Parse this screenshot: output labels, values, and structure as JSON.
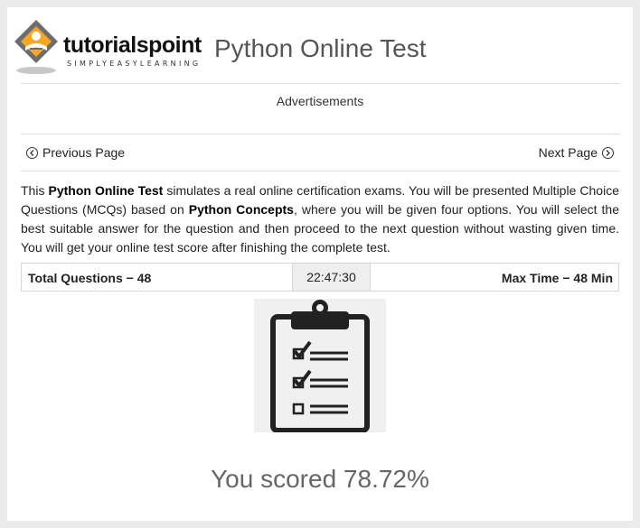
{
  "header": {
    "logo_text_main": "tutorials",
    "logo_text_accent": "point",
    "logo_tagline": "SIMPLYEASYLEARNING",
    "title": "Python Online Test"
  },
  "ads": {
    "label": "Advertisements"
  },
  "nav": {
    "previous_label": "Previous Page",
    "next_label": "Next Page"
  },
  "intro": {
    "p1": "This ",
    "b1": "Python Online Test",
    "p2": " simulates a real online certification exams. You will be presented Multiple Choice Questions (MCQs) based on ",
    "b2": "Python Concepts",
    "p3": ", where you will be given four options. You will select the best suitable answer for the question and then proceed to the next question without wasting given time. You will get your online test score after finishing the complete test."
  },
  "stats": {
    "total_questions": "Total Questions − 48",
    "timer": "22:47:30",
    "max_time": "Max Time − 48 Min"
  },
  "result": {
    "score_text": "You scored 78.72%"
  },
  "icons": {
    "logo": "tutorialspoint-logo",
    "prev": "chevron-left-circle-icon",
    "next": "chevron-right-circle-icon",
    "illustration": "clipboard-checklist-icon"
  },
  "colors": {
    "logo_orange": "#f5a623",
    "logo_gray": "#6d6d6d",
    "title_gray": "#555555",
    "background": "#ebebeb"
  }
}
